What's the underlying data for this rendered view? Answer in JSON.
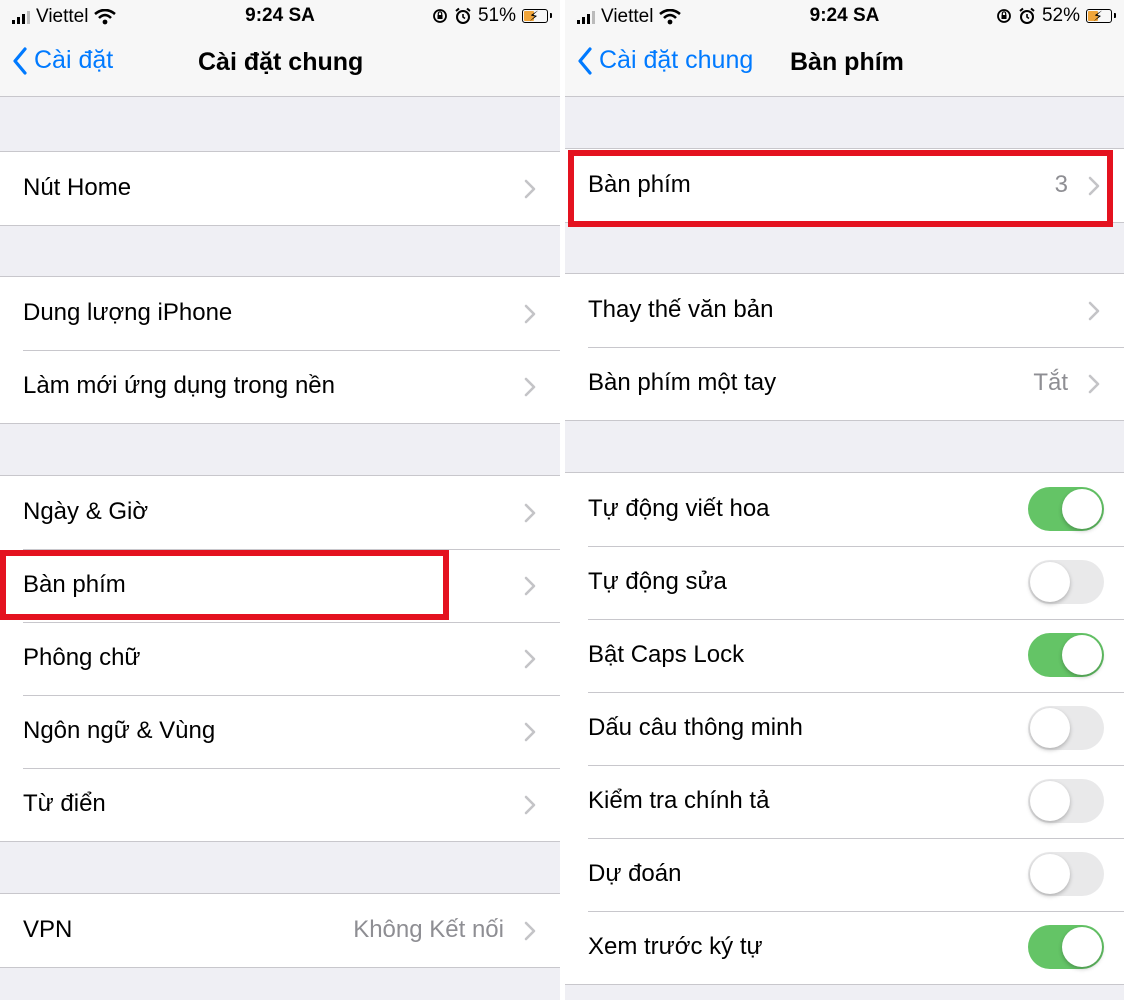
{
  "left": {
    "status": {
      "carrier": "Viettel",
      "time": "9:24 SA",
      "battery": "51%",
      "battery_level": 0.51
    },
    "nav": {
      "back_label": "Cài đặt",
      "title": "Cài đặt chung"
    },
    "groups": [
      [
        {
          "label": "Nút Home"
        }
      ],
      [
        {
          "label": "Dung lượng iPhone"
        },
        {
          "label": "Làm mới ứng dụng trong nền"
        }
      ],
      [
        {
          "label": "Ngày & Giờ"
        },
        {
          "label": "Bàn phím",
          "highlighted": true
        },
        {
          "label": "Phông chữ"
        },
        {
          "label": "Ngôn ngữ & Vùng"
        },
        {
          "label": "Từ điển"
        }
      ],
      [
        {
          "label": "VPN",
          "value": "Không Kết nối"
        }
      ]
    ]
  },
  "right": {
    "status": {
      "carrier": "Viettel",
      "time": "9:24 SA",
      "battery": "52%",
      "battery_level": 0.52
    },
    "nav": {
      "back_label": "Cài đặt chung",
      "title": "Bàn phím"
    },
    "groups": [
      [
        {
          "label": "Bàn phím",
          "value": "3",
          "highlighted": true
        }
      ],
      [
        {
          "label": "Thay thế văn bản"
        },
        {
          "label": "Bàn phím một tay",
          "value": "Tắt"
        }
      ],
      [
        {
          "label": "Tự động viết hoa",
          "toggle": true
        },
        {
          "label": "Tự động sửa",
          "toggle": false
        },
        {
          "label": "Bật Caps Lock",
          "toggle": true
        },
        {
          "label": "Dấu câu thông minh",
          "toggle": false
        },
        {
          "label": "Kiểm tra chính tả",
          "toggle": false
        },
        {
          "label": "Dự đoán",
          "toggle": false
        },
        {
          "label": "Xem trước ký tự",
          "toggle": true
        }
      ]
    ]
  },
  "colors": {
    "accent": "#007aff",
    "toggle_on": "#64c466",
    "highlight": "#e4121f",
    "background": "#efeff4"
  }
}
